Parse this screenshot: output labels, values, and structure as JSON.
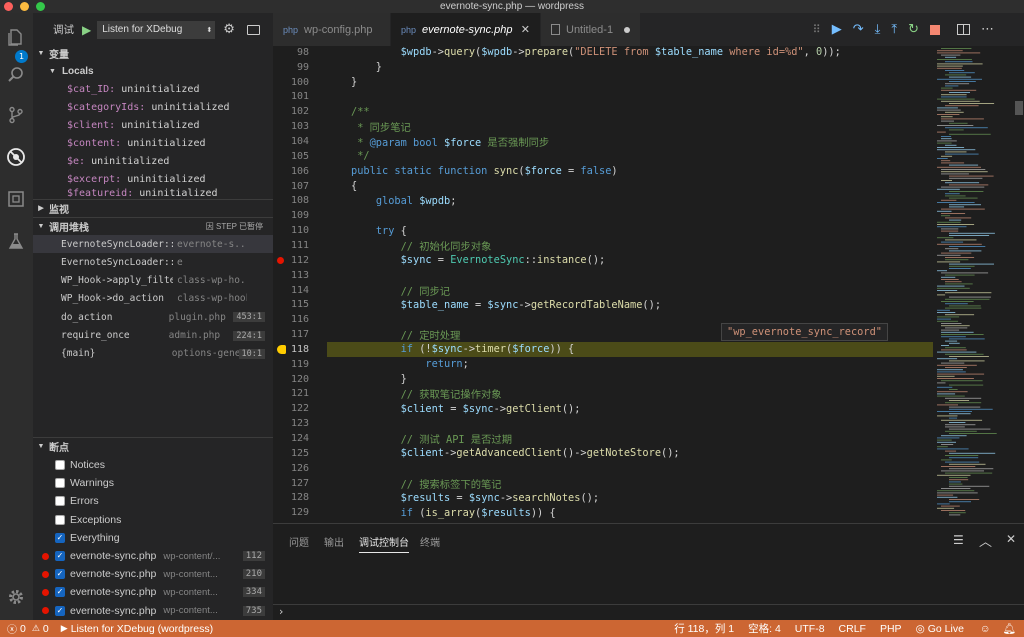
{
  "window": {
    "title": "evernote-sync.php — wordpress"
  },
  "activity": {
    "badge": "1"
  },
  "sidebar": {
    "debug_label": "调试",
    "config": "Listen for XDebug",
    "variables_header": "变量",
    "locals_header": "Locals",
    "locals": [
      {
        "name": "$cat_ID:",
        "value": "uninitialized"
      },
      {
        "name": "$categoryIds:",
        "value": "uninitialized"
      },
      {
        "name": "$client:",
        "value": "uninitialized"
      },
      {
        "name": "$content:",
        "value": "uninitialized"
      },
      {
        "name": "$e:",
        "value": "uninitialized"
      },
      {
        "name": "$excerpt:",
        "value": "uninitialized"
      },
      {
        "name": "$featureid:",
        "value": "uninitialized"
      }
    ],
    "watch_header": "监视",
    "callstack_header": "调用堆栈",
    "callstack_status": "因 STEP 已暂停",
    "callstack": [
      {
        "fn": "EvernoteSyncLoader::sync",
        "file": "evernote-s...",
        "line": ""
      },
      {
        "fn": "EvernoteSyncLoader::showOptionsPage",
        "file": "e",
        "line": ""
      },
      {
        "fn": "WP_Hook->apply_filters",
        "file": "class-wp-ho...",
        "line": ""
      },
      {
        "fn": "WP_Hook->do_action",
        "file": "class-wp-hook.p...",
        "line": ""
      },
      {
        "fn": "do_action",
        "file": "plugin.php",
        "line": "453:1"
      },
      {
        "fn": "require_once",
        "file": "admin.php",
        "line": "224:1"
      },
      {
        "fn": "{main}",
        "file": "options-general.php",
        "line": "10:1"
      }
    ],
    "breakpoints_header": "断点",
    "exceptions": [
      {
        "label": "Notices",
        "checked": false
      },
      {
        "label": "Warnings",
        "checked": false
      },
      {
        "label": "Errors",
        "checked": false
      },
      {
        "label": "Exceptions",
        "checked": false
      },
      {
        "label": "Everything",
        "checked": true
      }
    ],
    "breakpoints": [
      {
        "file": "evernote-sync.php",
        "path": "wp-content/...",
        "line": "112"
      },
      {
        "file": "evernote-sync.php",
        "path": "wp-content...",
        "line": "210"
      },
      {
        "file": "evernote-sync.php",
        "path": "wp-content...",
        "line": "334"
      },
      {
        "file": "evernote-sync.php",
        "path": "wp-content...",
        "line": "735"
      }
    ]
  },
  "tabs": [
    {
      "label": "wp-config.php"
    },
    {
      "label": "evernote-sync.php"
    },
    {
      "label": "Untitled-1"
    }
  ],
  "editor": {
    "hover": "\"wp_evernote_sync_record\"",
    "current_line": "118",
    "breakpoint_line": "112"
  },
  "panel": {
    "tabs": [
      "问题",
      "输出",
      "调试控制台",
      "终端"
    ],
    "prompt": "›"
  },
  "status": {
    "errors": "0",
    "warnings": "0",
    "config": "Listen for XDebug (wordpress)",
    "position": "行 118，列 1",
    "spaces": "空格: 4",
    "encoding": "UTF-8",
    "eol": "CRLF",
    "lang": "PHP",
    "golive": "Go Live"
  },
  "colors": {
    "status_bar": "#cc6633",
    "accent": "#007acc",
    "current_line": "#4b4b18",
    "breakpoint": "#e51400"
  }
}
